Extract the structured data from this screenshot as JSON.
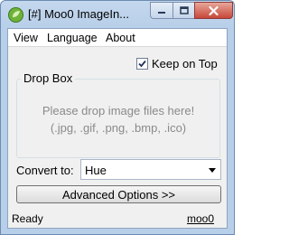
{
  "window": {
    "title": "[#] Moo0 ImageIn...",
    "app_icon": "moo0-leaf-icon",
    "controls": {
      "minimize": "minimize-icon",
      "maximize": "maximize-icon",
      "close": "close-icon"
    }
  },
  "menu": {
    "items": [
      {
        "label": "View"
      },
      {
        "label": "Language"
      },
      {
        "label": "About"
      }
    ]
  },
  "keep_on_top": {
    "label": "Keep on Top",
    "checked": true
  },
  "drop_box": {
    "legend": "Drop Box",
    "hint_line1": "Please drop image files here!",
    "hint_line2": "(.jpg, .gif, .png, .bmp, .ico)"
  },
  "convert": {
    "label": "Convert to:",
    "selected": "Hue"
  },
  "advanced_button": {
    "label": "Advanced Options >>"
  },
  "status": {
    "text": "Ready",
    "link": "moo0"
  },
  "colors": {
    "title_bar": "#c4d8ee",
    "client_bg": "#f0f0f0",
    "hint_text": "#8a8a8a",
    "close_button": "#c8483a"
  }
}
